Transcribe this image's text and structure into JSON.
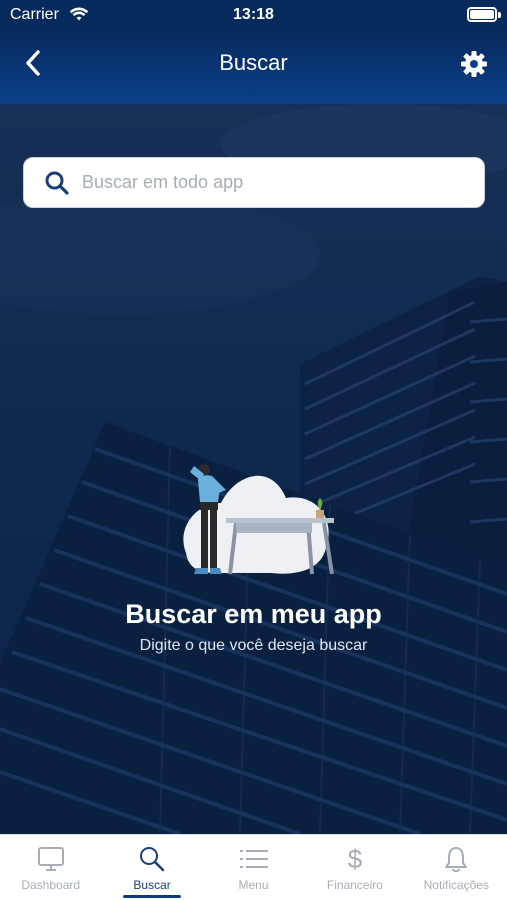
{
  "status_bar": {
    "carrier": "Carrier",
    "time": "13:18",
    "wifi_icon": "wifi-icon",
    "battery_icon": "battery-icon"
  },
  "nav": {
    "title": "Buscar",
    "back_icon": "chevron-left-icon",
    "settings_icon": "gear-icon"
  },
  "search": {
    "placeholder": "Buscar em todo app",
    "value": "",
    "icon": "search-icon"
  },
  "empty_state": {
    "title": "Buscar em meu app",
    "subtitle": "Digite o que você deseja buscar"
  },
  "tabs": [
    {
      "label": "Dashboard",
      "icon": "monitor-icon",
      "active": false
    },
    {
      "label": "Buscar",
      "icon": "search-icon",
      "active": true
    },
    {
      "label": "Menu",
      "icon": "list-icon",
      "active": false
    },
    {
      "label": "Financeiro",
      "icon": "dollar-icon",
      "active": false
    },
    {
      "label": "Notificações",
      "icon": "bell-icon",
      "active": false
    }
  ],
  "colors": {
    "header": "#0a3f8a",
    "background": "#12284a",
    "active_tab": "#1a3f7a",
    "inactive_tab": "#a7adb6"
  }
}
